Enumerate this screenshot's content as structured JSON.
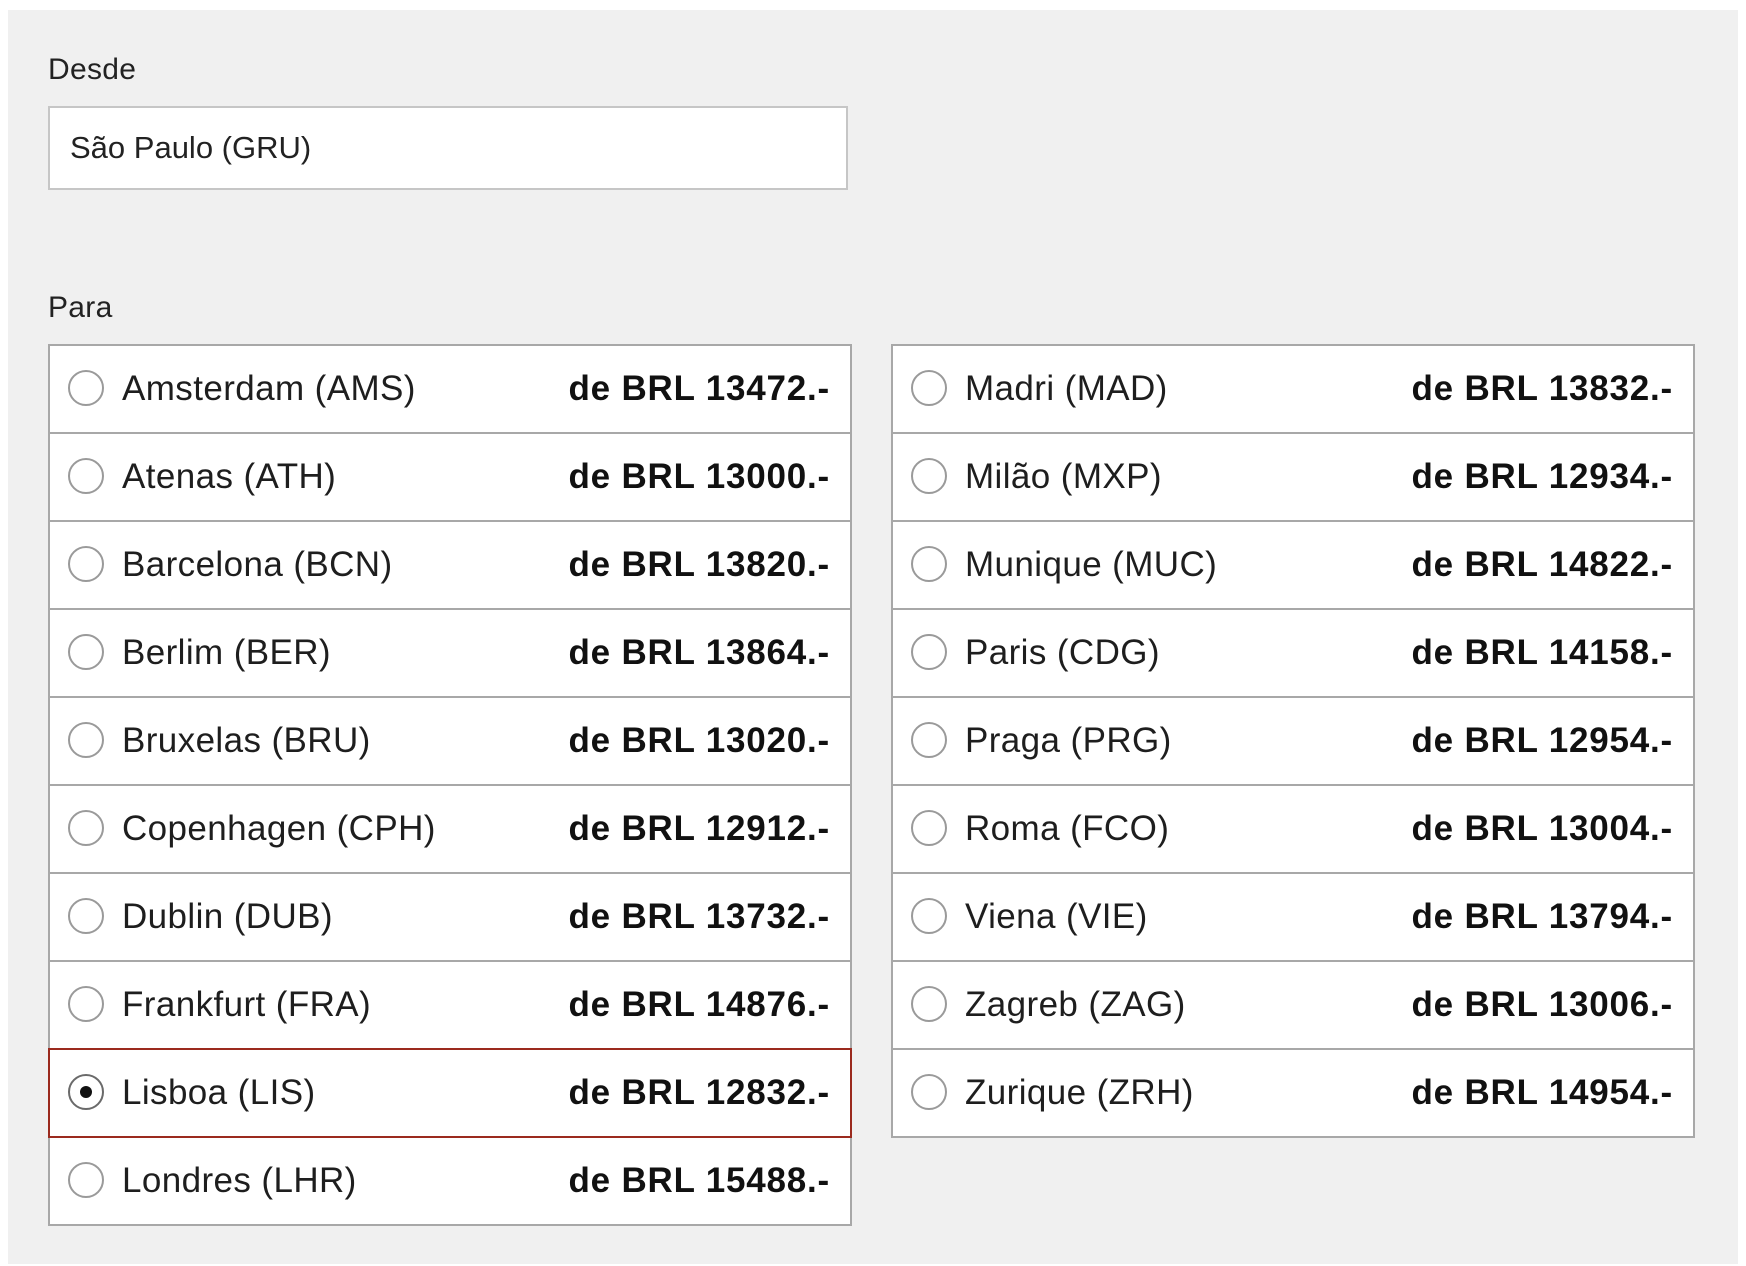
{
  "from": {
    "label": "Desde",
    "value": "São Paulo (GRU)"
  },
  "to": {
    "label": "Para",
    "selected_index": 8,
    "left_column": [
      {
        "city": "Amsterdam (AMS)",
        "price": "de BRL 13472.-"
      },
      {
        "city": "Atenas (ATH)",
        "price": "de BRL 13000.-"
      },
      {
        "city": "Barcelona (BCN)",
        "price": "de BRL 13820.-"
      },
      {
        "city": "Berlim (BER)",
        "price": "de BRL 13864.-"
      },
      {
        "city": "Bruxelas (BRU)",
        "price": "de BRL 13020.-"
      },
      {
        "city": "Copenhagen (CPH)",
        "price": "de BRL 12912.-"
      },
      {
        "city": "Dublin (DUB)",
        "price": "de BRL 13732.-"
      },
      {
        "city": "Frankfurt (FRA)",
        "price": "de BRL 14876.-"
      },
      {
        "city": "Lisboa (LIS)",
        "price": "de BRL 12832.-",
        "selected": true
      },
      {
        "city": "Londres (LHR)",
        "price": "de BRL 15488.-"
      }
    ],
    "right_column": [
      {
        "city": "Madri (MAD)",
        "price": "de BRL 13832.-"
      },
      {
        "city": "Milão (MXP)",
        "price": "de BRL 12934.-"
      },
      {
        "city": "Munique (MUC)",
        "price": "de BRL 14822.-"
      },
      {
        "city": "Paris (CDG)",
        "price": "de BRL 14158.-"
      },
      {
        "city": "Praga (PRG)",
        "price": "de BRL 12954.-"
      },
      {
        "city": "Roma (FCO)",
        "price": "de BRL 13004.-"
      },
      {
        "city": "Viena (VIE)",
        "price": "de BRL 13794.-"
      },
      {
        "city": "Zagreb (ZAG)",
        "price": "de BRL 13006.-"
      },
      {
        "city": "Zurique (ZRH)",
        "price": "de BRL 14954.-"
      }
    ]
  },
  "colors": {
    "panel_background": "#f0f0f0",
    "selected_border": "#9b2a1e",
    "row_border": "#a8a8a8"
  }
}
